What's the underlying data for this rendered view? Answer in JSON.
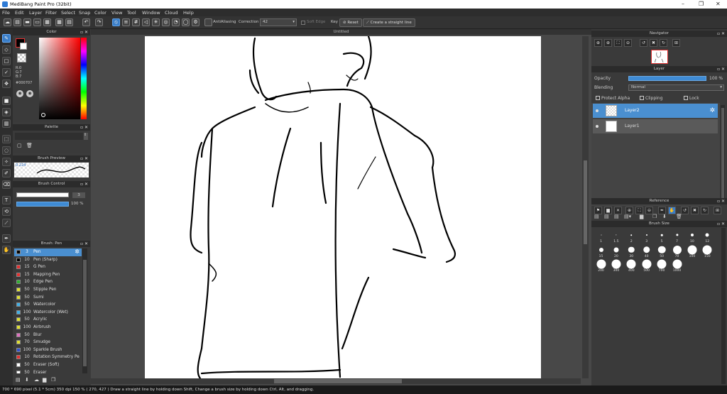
{
  "app": {
    "title": "MediBang Paint Pro (32bit)"
  },
  "window_controls": {
    "minimize": "–",
    "restore": "❐",
    "close": "✕"
  },
  "menu": [
    "File",
    "Edit",
    "Layer",
    "Filter",
    "Select",
    "Snap",
    "Color",
    "View",
    "Tool",
    "Window",
    "Cloud",
    "Help"
  ],
  "toolbar": {
    "antialiasing": "AntiAliasing",
    "correction_label": "Correction",
    "correction_value": "42",
    "soft_edge": "Soft Edge",
    "key_label": "Key",
    "reset": "Reset",
    "straight_line": "Create a straight line"
  },
  "canvas": {
    "tab_title": "Untitled"
  },
  "color_panel": {
    "title": "Color",
    "r": "R:0",
    "g": "G:7",
    "b": "B:7",
    "hex": "#000707",
    "accent": "#ff0000"
  },
  "palette_panel": {
    "title": "Palette"
  },
  "brush_preview": {
    "title": "Brush Preview",
    "size": "0.224"
  },
  "brush_control": {
    "title": "Brush Control",
    "size_value": "3",
    "opacity_value": "100 %"
  },
  "brush_list": {
    "title": "Brush: Pen",
    "items": [
      {
        "size": "3",
        "name": "Pen",
        "color": "#000000",
        "selected": true
      },
      {
        "size": "10",
        "name": "Pen (Sharp)",
        "color": "#000000"
      },
      {
        "size": "15",
        "name": "G Pen",
        "color": "#e53030"
      },
      {
        "size": "15",
        "name": "Mapping Pen",
        "color": "#e53030"
      },
      {
        "size": "10",
        "name": "Edge Pen",
        "color": "#30b030"
      },
      {
        "size": "50",
        "name": "Stipple Pen",
        "color": "#e0e030"
      },
      {
        "size": "50",
        "name": "Sumi",
        "color": "#e0e030"
      },
      {
        "size": "50",
        "name": "Watercolor",
        "color": "#40b0e8"
      },
      {
        "size": "100",
        "name": "Watercolor (Wet)",
        "color": "#40b0e8"
      },
      {
        "size": "50",
        "name": "Acrylic",
        "color": "#e0e030"
      },
      {
        "size": "100",
        "name": "Airbrush",
        "color": "#e0e030"
      },
      {
        "size": "50",
        "name": "Blur",
        "color": "#e070c0"
      },
      {
        "size": "70",
        "name": "Smudge",
        "color": "#e0e030"
      },
      {
        "size": "100",
        "name": "Sparkle Brush",
        "color": "#3050d0"
      },
      {
        "size": "10",
        "name": "Rotation Symmetry Pe",
        "color": "#e53030"
      },
      {
        "size": "50",
        "name": "Eraser (Soft)",
        "color": "#ffffff"
      },
      {
        "size": "50",
        "name": "Eraser",
        "color": "#ffffff"
      }
    ]
  },
  "navigator": {
    "title": "Navigator"
  },
  "layer_panel": {
    "title": "Layer",
    "opacity_label": "Opacity",
    "opacity_value": "100 %",
    "blending_label": "Blending",
    "blending_value": "Normal",
    "protect_alpha": "Protect Alpha",
    "clipping": "Clipping",
    "lock": "Lock",
    "layers": [
      "Layer2",
      "Layer1"
    ]
  },
  "reference": {
    "title": "Reference"
  },
  "brush_size": {
    "title": "Brush Size",
    "sizes": [
      "1",
      "1.5",
      "2",
      "3",
      "5",
      "7",
      "10",
      "12",
      "15",
      "20",
      "30",
      "40",
      "50",
      "70",
      "100",
      "150",
      "200",
      "300",
      "400",
      "500",
      "700",
      "1000"
    ]
  },
  "status": "700 * 690 pixel   (5.1 * 5cm)   350 dpi   150 %   ( 270, 427 )   Draw a straight line by holding down Shift, Change a brush size by holding down Ctrl, Alt, and dragging."
}
